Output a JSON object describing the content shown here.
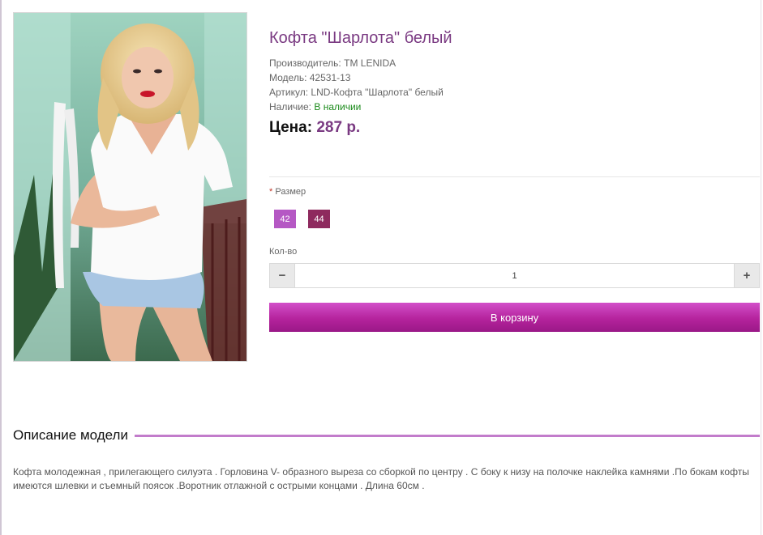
{
  "product": {
    "title": "Кофта \"Шарлота\" белый",
    "manufacturer_label": "Производитель:",
    "manufacturer": "ТМ LENIDA",
    "model_label": "Модель:",
    "model": "42531-13",
    "sku_label": "Артикул:",
    "sku": "LND-Кофта \"Шарлота\" белый",
    "availability_label": "Наличие:",
    "availability": "В наличии",
    "price_label": "Цена:",
    "price": "287 р."
  },
  "options": {
    "required_mark": "*",
    "size_label": "Размер",
    "sizes": [
      "42",
      "44"
    ],
    "qty_label": "Кол-во",
    "qty_minus": "−",
    "qty_plus": "+",
    "qty_value": "1"
  },
  "cart": {
    "button_label": "В корзину"
  },
  "description": {
    "heading": "Описание модели",
    "text": "Кофта молодежная , прилегающего силуэта . Горловина V- образного выреза со сборкой по центру . С боку к низу на полочке наклейка камнями .По бокам кофты имеются шлевки и съемный поясок .Воротник отлажной с острыми концами . Длина 60см ."
  },
  "colors": {
    "title": "#7a3a82",
    "accent": "#b5239d",
    "in_stock": "#1a8a1a",
    "size_42": "#b558c4",
    "size_44": "#8e2a5e",
    "desc_line": "#c27ccb"
  }
}
